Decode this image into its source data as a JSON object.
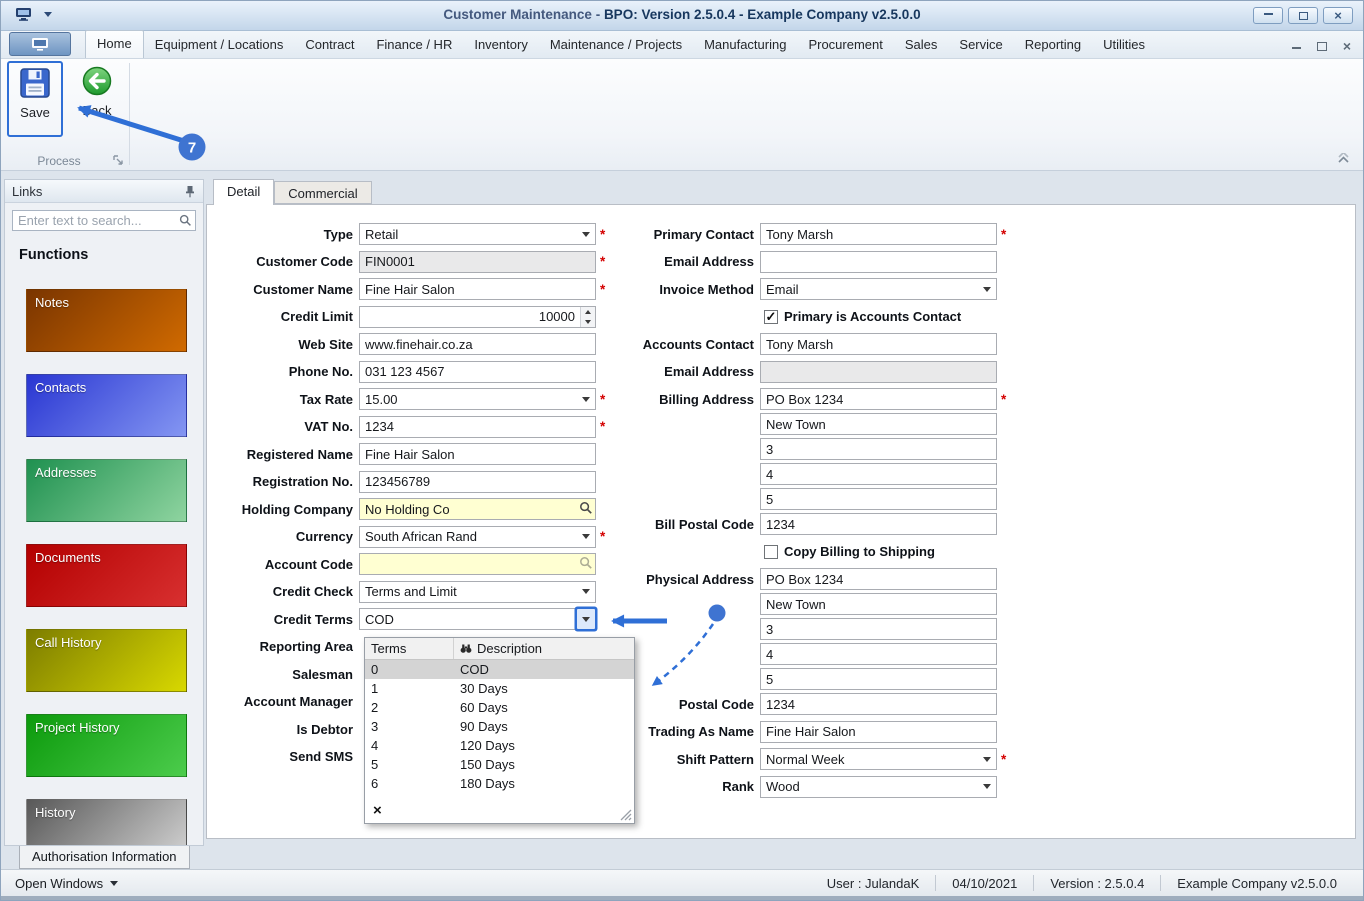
{
  "window": {
    "title_prefix": "Customer Maintenance - ",
    "title_main": "BPO: Version 2.5.0.4 - Example Company v2.5.0.0"
  },
  "icons": {
    "check": "✓",
    "close": "×",
    "clear": "×"
  },
  "ribbon": {
    "tabs": [
      "Home",
      "Equipment / Locations",
      "Contract",
      "Finance / HR",
      "Inventory",
      "Maintenance / Projects",
      "Manufacturing",
      "Procurement",
      "Sales",
      "Service",
      "Reporting",
      "Utilities"
    ],
    "save_label": "Save",
    "back_label": "Back",
    "group_label": "Process"
  },
  "annotations": {
    "step": "7"
  },
  "sidebar": {
    "header": "Links",
    "search_placeholder": "Enter text to search...",
    "section_title": "Functions",
    "items": [
      {
        "label": "Notes",
        "from": "#7a3500",
        "to": "#d06a00"
      },
      {
        "label": "Contacts",
        "from": "#2936d2",
        "to": "#8496f2"
      },
      {
        "label": "Addresses",
        "from": "#1f9150",
        "to": "#8fd4a0"
      },
      {
        "label": "Documents",
        "from": "#b30000",
        "to": "#d83030"
      },
      {
        "label": "Call History",
        "from": "#7d7d00",
        "to": "#d8d800"
      },
      {
        "label": "Project History",
        "from": "#0c9a0c",
        "to": "#4ccc4c"
      },
      {
        "label": "History",
        "from": "#585858",
        "to": "#d4d4d4"
      }
    ],
    "bottom_tab": "Authorisation Information"
  },
  "main": {
    "tabs": [
      {
        "label": "Detail"
      },
      {
        "label": "Commercial"
      }
    ]
  },
  "form": {
    "req_mark": "*",
    "left": [
      {
        "label": "Type",
        "value": "Retail",
        "req": "*"
      },
      {
        "label": "Customer Code",
        "value": "FIN0001",
        "req": "*"
      },
      {
        "label": "Customer Name",
        "value": "Fine Hair Salon",
        "req": "*"
      },
      {
        "label": "Credit Limit",
        "value": "10000"
      },
      {
        "label": "Web Site",
        "value": "www.finehair.co.za"
      },
      {
        "label": "Phone No.",
        "value": "031 123 4567"
      },
      {
        "label": "Tax Rate",
        "value": "15.00",
        "req": "*"
      },
      {
        "label": "VAT No.",
        "value": "1234",
        "req": "*"
      },
      {
        "label": "Registered Name",
        "value": "Fine Hair Salon"
      },
      {
        "label": "Registration No.",
        "value": "123456789"
      },
      {
        "label": "Holding Company",
        "value": "No Holding Co"
      },
      {
        "label": "Currency",
        "value": "South African Rand",
        "req": "*"
      },
      {
        "label": "Account Code",
        "value": ""
      },
      {
        "label": "Credit Check",
        "value": "Terms and Limit"
      },
      {
        "label": "Credit Terms",
        "value": "COD"
      },
      {
        "label": "Reporting Area"
      },
      {
        "label": "Salesman"
      },
      {
        "label": "Account Manager"
      },
      {
        "label": "Is Debtor"
      },
      {
        "label": "Send SMS"
      }
    ],
    "right": [
      {
        "label": "Primary Contact",
        "value": "Tony Marsh",
        "req": "*"
      },
      {
        "label": "Email Address",
        "value": ""
      },
      {
        "label": "Invoice Method",
        "value": "Email"
      },
      {
        "label": "Primary is Accounts Contact",
        "checked": true
      },
      {
        "label": "Accounts Contact",
        "value": "Tony Marsh"
      },
      {
        "label": "Email Address",
        "value": ""
      },
      {
        "label": "Billing Address",
        "value": "PO Box 1234",
        "req": "*"
      },
      {
        "label": "",
        "value": "New Town"
      },
      {
        "label": "",
        "value": "3"
      },
      {
        "label": "",
        "value": "4"
      },
      {
        "label": "",
        "value": "5"
      },
      {
        "label": "Bill Postal Code",
        "value": "1234"
      },
      {
        "label": "Copy Billing to Shipping",
        "checked": false
      },
      {
        "label": "Physical Address",
        "value": "PO Box 1234"
      },
      {
        "label": "",
        "value": "New Town"
      },
      {
        "label": "",
        "value": "3"
      },
      {
        "label": "",
        "value": "4"
      },
      {
        "label": "",
        "value": "5"
      },
      {
        "label": "Postal Code",
        "value": "1234"
      },
      {
        "label": "Trading As Name",
        "value": "Fine Hair Salon"
      },
      {
        "label": "Shift Pattern",
        "value": "Normal Week",
        "req": "*"
      },
      {
        "label": "Rank",
        "value": "Wood"
      }
    ]
  },
  "dd": {
    "col_terms": "Terms",
    "col_desc": "Description",
    "rows": [
      [
        "0",
        "COD"
      ],
      [
        "1",
        "30 Days"
      ],
      [
        "2",
        "60 Days"
      ],
      [
        "3",
        "90 Days"
      ],
      [
        "4",
        "120 Days"
      ],
      [
        "5",
        "150 Days"
      ],
      [
        "6",
        "180 Days"
      ]
    ]
  },
  "statusbar": {
    "open_windows": "Open Windows",
    "user": "User : JulandaK",
    "date": "04/10/2021",
    "version": "Version : 2.5.0.4",
    "company": "Example Company v2.5.0.0"
  }
}
